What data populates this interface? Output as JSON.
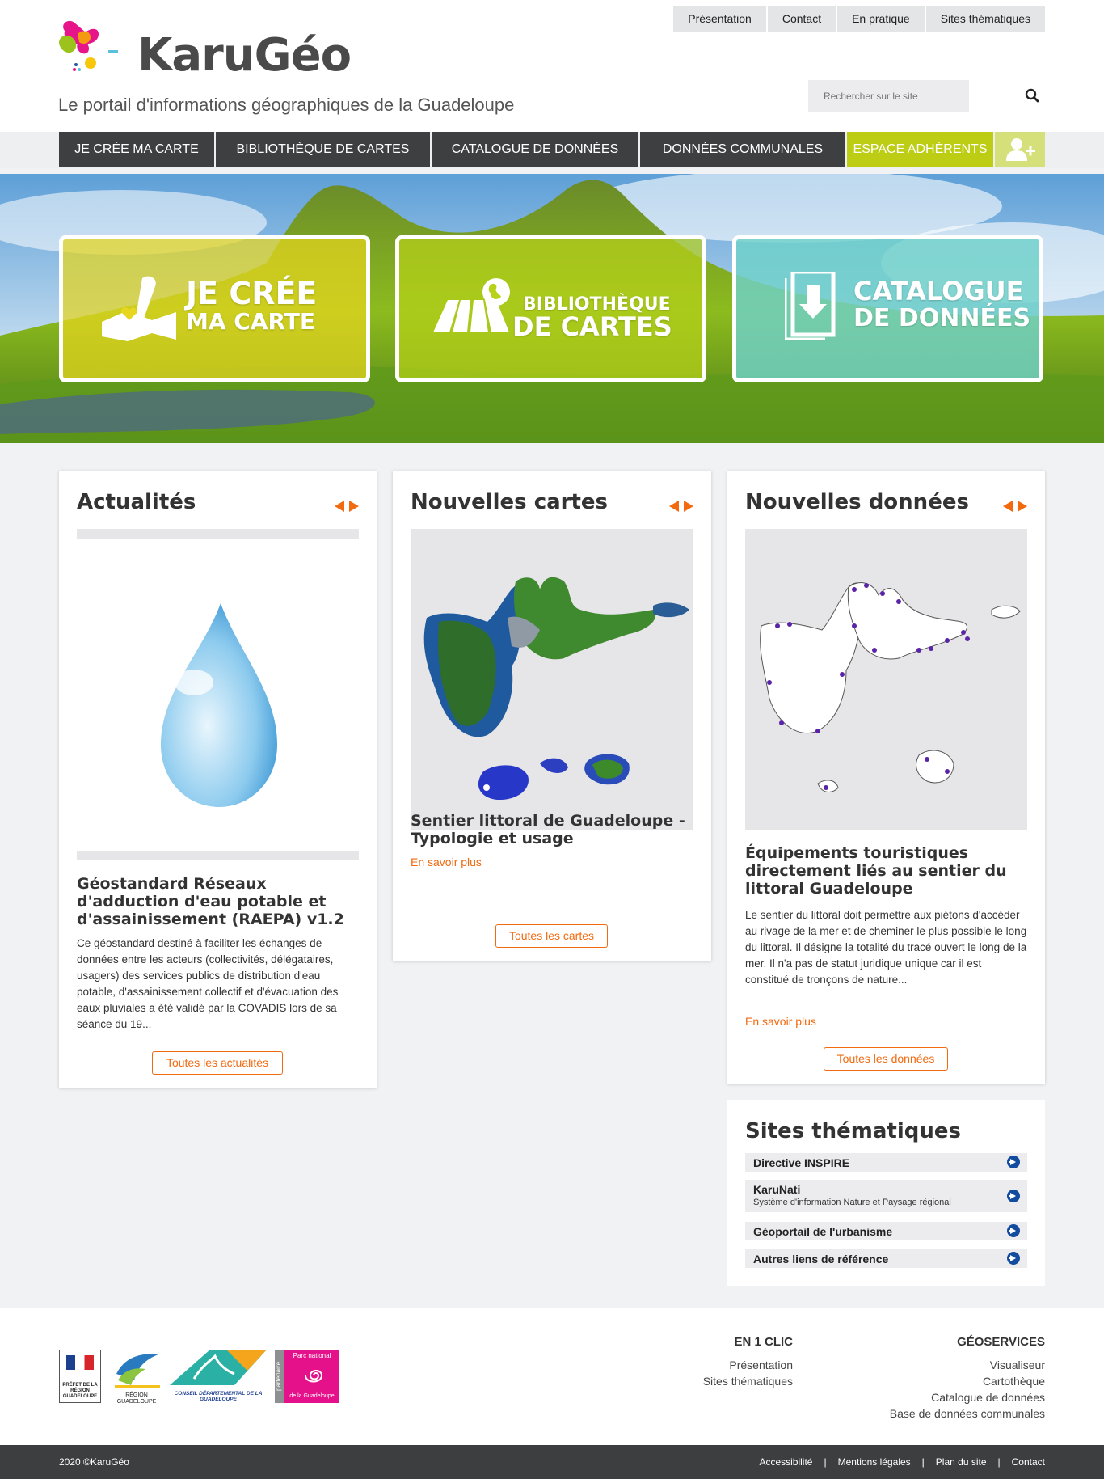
{
  "site": {
    "name": "KaruGéo",
    "tagline": "Le portail d'informations géographiques de la Guadeloupe"
  },
  "topnav": [
    "Présentation",
    "Contact",
    "En pratique",
    "Sites thématiques"
  ],
  "search": {
    "placeholder": "Rechercher sur le site"
  },
  "mainnav": {
    "items": [
      "JE CRÉE MA CARTE",
      "BIBLIOTHÈQUE DE CARTES",
      "CATALOGUE DE DONNÉES",
      "DONNÉES COMMUNALES"
    ],
    "member": "ESPACE ADHÉRENTS"
  },
  "hero": {
    "tiles": [
      {
        "line1": "JE CRÉE",
        "line2": "MA CARTE",
        "color": "#e6d61e"
      },
      {
        "line1": "BIBLIOTHÈQUE",
        "line2": "DE CARTES",
        "color": "#b8d21a"
      },
      {
        "line1": "CATALOGUE",
        "line2": "DE DONNÉES",
        "color": "#6fd1c9"
      }
    ]
  },
  "news": {
    "title": "Actualités",
    "item_title": "Géostandard Réseaux d'adduction d'eau potable et d'assainissement (RAEPA) v1.2",
    "item_text": "Ce géostandard destiné à faciliter les échanges de données entre les acteurs (collectivités, délégataires, usagers) des services publics de distribution d'eau potable, d'assainissement collectif et d'évacuation des eaux pluviales a été validé par la COVADIS lors de sa séance du 19...",
    "all": "Toutes les actualités"
  },
  "maps": {
    "title": "Nouvelles cartes",
    "item_title": "Sentier littoral de Guadeloupe - Typologie et usage",
    "more": "En savoir plus",
    "all": "Toutes les cartes"
  },
  "data": {
    "title": "Nouvelles données",
    "item_title": "Équipements touristiques directement liés au sentier du littoral Guadeloupe",
    "item_text": "Le sentier du littoral doit permettre aux piétons d'accéder au rivage de la mer et de cheminer le plus possible le long du littoral. Il désigne la totalité du tracé ouvert le long de la mer. Il n'a pas de statut juridique unique car il est constitué de tronçons de nature...",
    "more": "En savoir plus",
    "all": "Toutes les données"
  },
  "themes": {
    "title": "Sites thématiques",
    "items": [
      {
        "label": "Directive INSPIRE",
        "sub": ""
      },
      {
        "label": "KaruNati",
        "sub": "Système d'information Nature et Paysage régional"
      },
      {
        "label": "Géoportail de l'urbanisme",
        "sub": ""
      },
      {
        "label": "Autres liens de référence",
        "sub": ""
      }
    ]
  },
  "partners": {
    "prefet": "PRÉFET DE LA RÉGION GUADELOUPE",
    "region": "RÉGION GUADELOUPE",
    "cd": "CONSEIL DÉPARTEMENTAL DE LA GUADELOUPE",
    "parc_tag": "partenaire",
    "parc_name": "Parc national",
    "parc_place": "de la Guadeloupe"
  },
  "footer": {
    "col1": {
      "title": "EN 1 CLIC",
      "links": [
        "Présentation",
        "Sites thématiques"
      ]
    },
    "col2": {
      "title": "GÉOSERVICES",
      "links": [
        "Visualiseur",
        "Cartothèque",
        "Catalogue de données",
        "Base de données communales"
      ]
    }
  },
  "bottombar": {
    "copyright": "2020 ©KaruGéo",
    "links": [
      "Accessibilité",
      "Mentions légales",
      "Plan du site",
      "Contact"
    ]
  },
  "colors": {
    "accent": "#f26a10",
    "nav_dark": "#3e3f41",
    "member_green": "#bccd14",
    "theme_go": "#134b9e"
  }
}
